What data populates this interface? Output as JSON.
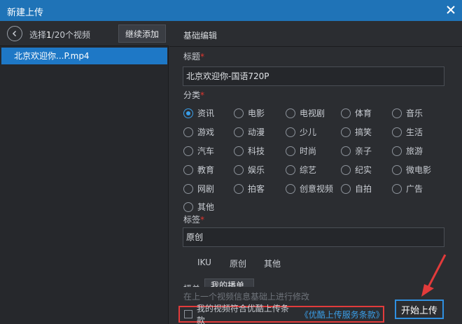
{
  "window": {
    "title": "新建上传",
    "accent": "#1f73b7"
  },
  "left": {
    "count_prefix": "选择",
    "count_current": "1",
    "count_suffix": "/20个视频",
    "add_button": "继续添加",
    "files": [
      "北京欢迎你...P.mp4"
    ]
  },
  "right": {
    "tab": "基础编辑",
    "title_label": "标题",
    "title_value": "北京欢迎你-国语720P",
    "category_label": "分类",
    "categories": [
      [
        "资讯",
        "电影",
        "电视剧",
        "体育",
        "音乐"
      ],
      [
        "游戏",
        "动漫",
        "少儿",
        "搞笑",
        "生活"
      ],
      [
        "汽车",
        "科技",
        "时尚",
        "亲子",
        "旅游"
      ],
      [
        "教育",
        "娱乐",
        "综艺",
        "纪实",
        "微电影"
      ],
      [
        "网剧",
        "拍客",
        "创意视频",
        "自拍",
        "广告"
      ],
      [
        "其他"
      ]
    ],
    "selected_category": "资讯",
    "tags_label": "标签",
    "tags_value": "原创",
    "tag_suggestions": [
      "IKU",
      "原创",
      "其他"
    ],
    "cover_label": "播单",
    "cover_tab": "我的播单"
  },
  "footer": {
    "hint": "在上一个视频信息基础上进行修改",
    "agree_text": "我的视频符合优酷上传条款",
    "agree_link": "《优酷上传服务条款》",
    "start_button": "开始上传",
    "highlight_color": "#e23b3b"
  }
}
